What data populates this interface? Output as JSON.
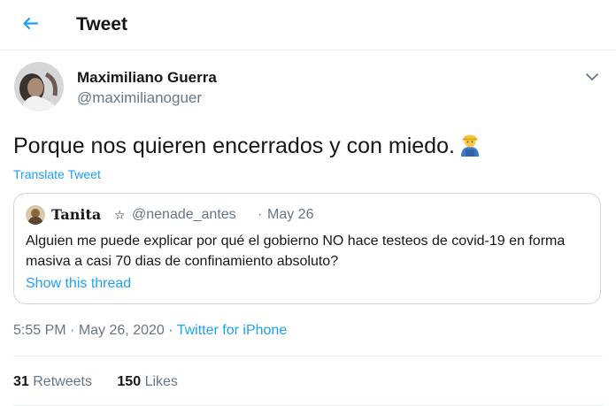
{
  "header": {
    "title": "Tweet",
    "back_icon": "arrow-left-icon"
  },
  "author": {
    "name": "Maximiliano Guerra",
    "handle": "@maximilianoguer"
  },
  "tweet": {
    "text": "Porque nos quieren encerrados y con miedo.",
    "emoji": "man-factory-worker-emoji",
    "translate_label": "Translate Tweet"
  },
  "quote": {
    "name": "Tanita",
    "badge": "☆",
    "handle": "@nenade_antes",
    "separator": "·",
    "date": "May 26",
    "text": "Alguien me puede explicar por qué el gobierno NO hace testeos de covid-19 en forma masiva a casi 70 dias de confinamiento absoluto?",
    "show_thread_label": "Show this thread"
  },
  "meta": {
    "time": "5:55 PM",
    "separator": "·",
    "date": "May 26, 2020",
    "source": "Twitter for iPhone"
  },
  "stats": {
    "retweets_count": "31",
    "retweets_label": "Retweets",
    "likes_count": "150",
    "likes_label": "Likes"
  },
  "colors": {
    "accent": "#1da1f2",
    "text": "#14171a",
    "secondary": "#657786",
    "border": "#ccd6dd"
  }
}
